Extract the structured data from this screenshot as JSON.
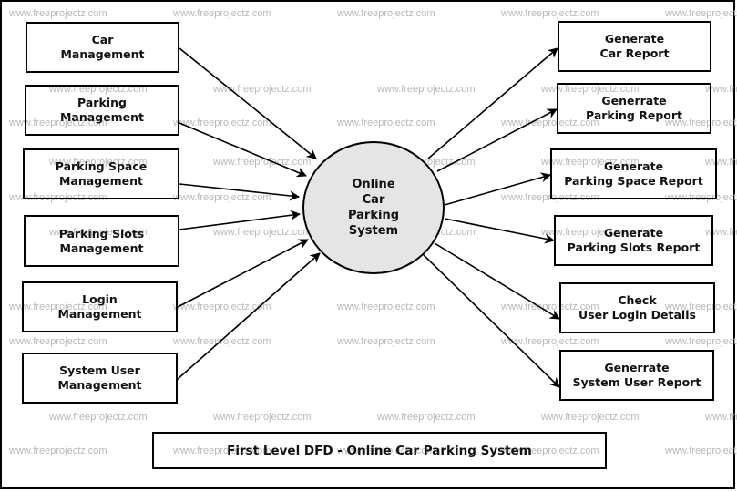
{
  "diagram": {
    "type": "data-flow-diagram",
    "level": "First Level",
    "title": "First Level DFD - Online Car Parking System",
    "watermark": "www.freeprojectz.com",
    "colors": {
      "process_fill": "#e5e5e5",
      "stroke": "#000000",
      "watermark": "#b8b8b8"
    },
    "process": {
      "id": "p0",
      "label": "Online\nCar\nParking\nSystem"
    },
    "inputs": [
      {
        "id": "in-car",
        "label": "Car\nManagement"
      },
      {
        "id": "in-parking",
        "label": "Parking\nManagement"
      },
      {
        "id": "in-space",
        "label": "Parking Space\nManagement"
      },
      {
        "id": "in-slots",
        "label": "Parking Slots\nManagement"
      },
      {
        "id": "in-login",
        "label": "Login\nManagement"
      },
      {
        "id": "in-sysuser",
        "label": "System User\nManagement"
      }
    ],
    "outputs": [
      {
        "id": "out-car",
        "label": "Generate\nCar Report"
      },
      {
        "id": "out-parking",
        "label": "Generrate\nParking Report"
      },
      {
        "id": "out-space",
        "label": "Generate\nParking Space Report"
      },
      {
        "id": "out-slots",
        "label": "Generate\nParking Slots Report"
      },
      {
        "id": "out-login",
        "label": "Check\nUser Login Details"
      },
      {
        "id": "out-sysuser",
        "label": "Generrate\nSystem User Report"
      }
    ],
    "flows": [
      {
        "from": "in-car",
        "to": "p0"
      },
      {
        "from": "in-parking",
        "to": "p0"
      },
      {
        "from": "in-space",
        "to": "p0"
      },
      {
        "from": "in-slots",
        "to": "p0"
      },
      {
        "from": "in-login",
        "to": "p0"
      },
      {
        "from": "in-sysuser",
        "to": "p0"
      },
      {
        "from": "p0",
        "to": "out-car"
      },
      {
        "from": "p0",
        "to": "out-parking"
      },
      {
        "from": "p0",
        "to": "out-space"
      },
      {
        "from": "p0",
        "to": "out-slots"
      },
      {
        "from": "p0",
        "to": "out-login"
      },
      {
        "from": "p0",
        "to": "out-sysuser"
      }
    ]
  }
}
